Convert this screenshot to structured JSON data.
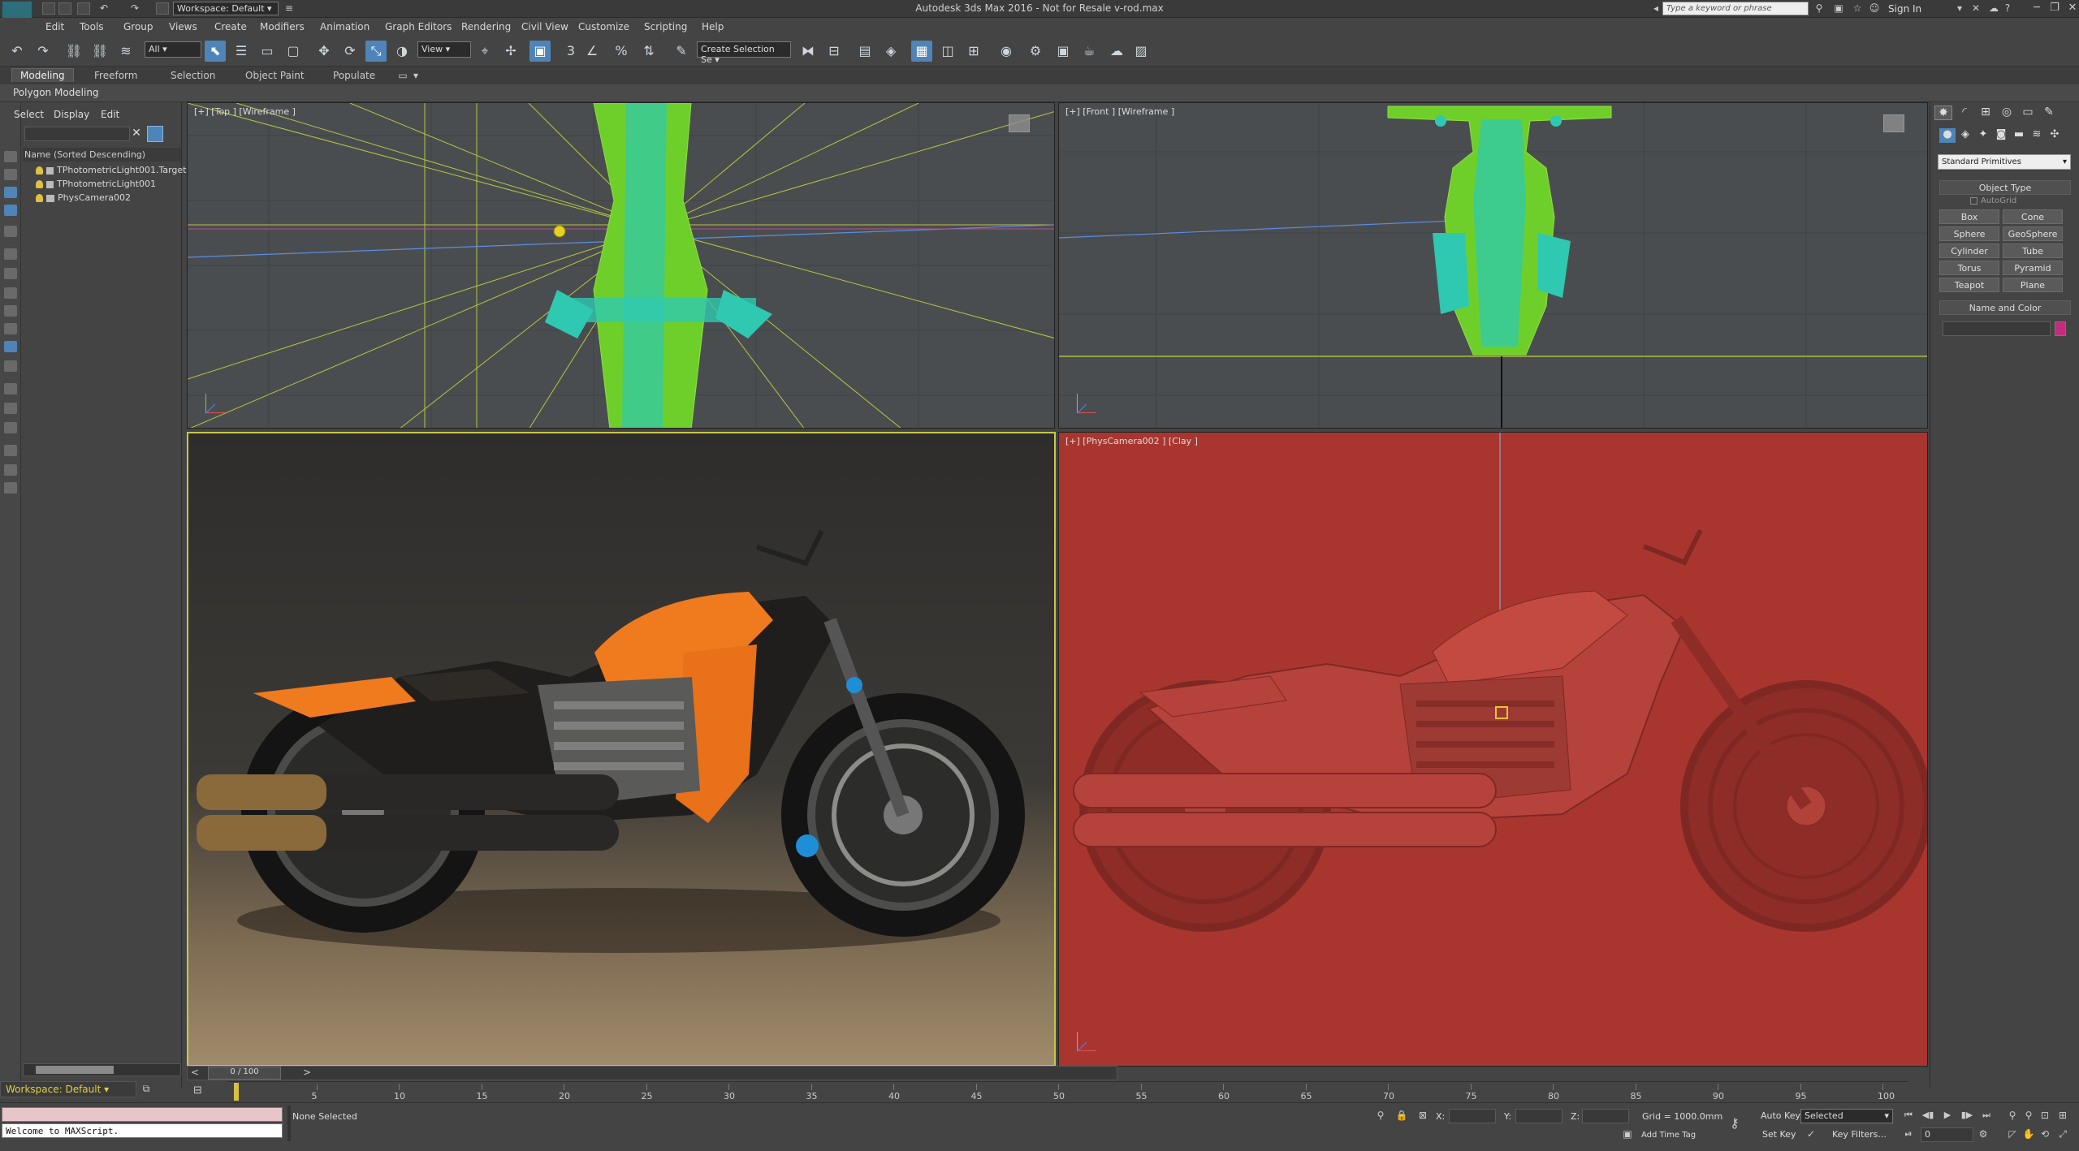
{
  "app": {
    "title": "Autodesk 3ds Max 2016 - Not for Resale    v-rod.max",
    "logo": "MAX",
    "workspace_label": "Workspace: Default",
    "search_placeholder": "Type a keyword or phrase",
    "sign_in": "Sign In",
    "window_controls": [
      "minimize-icon",
      "restore-icon",
      "close-icon"
    ]
  },
  "menu": [
    "Edit",
    "Tools",
    "Group",
    "Views",
    "Create",
    "Modifiers",
    "Animation",
    "Graph Editors",
    "Rendering",
    "Civil View",
    "Customize",
    "Scripting",
    "Help"
  ],
  "toolbar": {
    "selection_filter": "All",
    "reference_coord": "View",
    "named_selection": "Create Selection Se",
    "snap_label": "3"
  },
  "ribbon": {
    "tabs": [
      "Modeling",
      "Freeform",
      "Selection",
      "Object Paint",
      "Populate"
    ],
    "active_tab": "Modeling",
    "sub_label": "Polygon Modeling"
  },
  "explorer": {
    "tabs": [
      "Select",
      "Display",
      "Edit"
    ],
    "column_header": "Name (Sorted Descending)",
    "items": [
      {
        "name": "TPhotometricLight001.Target",
        "icon": "light-bulb-icon"
      },
      {
        "name": "TPhotometricLight001",
        "icon": "light-bulb-icon"
      },
      {
        "name": "PhysCamera002",
        "icon": "camera-icon"
      }
    ],
    "workspace_bottom": "Workspace: Default"
  },
  "viewports": {
    "top": {
      "label": "[+] [Top ] [Wireframe ]"
    },
    "front": {
      "label": "[+] [Front ] [Wireframe ]"
    },
    "render": {
      "label": ""
    },
    "camera": {
      "label": "[+] [PhysCamera002 ] [Clay ]"
    }
  },
  "command_panel": {
    "category": "Standard Primitives",
    "object_type_header": "Object Type",
    "autogrid": "AutoGrid",
    "object_buttons": [
      "Box",
      "Cone",
      "Sphere",
      "GeoSphere",
      "Cylinder",
      "Tube",
      "Torus",
      "Pyramid",
      "Teapot",
      "Plane"
    ],
    "name_color_header": "Name and Color",
    "object_color": "#c42b7c"
  },
  "timeline": {
    "current": "0 / 100",
    "ticks": [
      "5",
      "10",
      "15",
      "20",
      "25",
      "30",
      "35",
      "40",
      "45",
      "50",
      "55",
      "60",
      "65",
      "70",
      "75",
      "80",
      "85",
      "90",
      "95",
      "100"
    ]
  },
  "status": {
    "maxscript_output": "",
    "maxscript_input": "Welcome to MAXScript.",
    "selection": "None Selected",
    "x_label": "X:",
    "y_label": "Y:",
    "z_label": "Z:",
    "grid": "Grid = 1000.0mm",
    "add_time_tag": "Add Time Tag",
    "auto_key": "Auto Key",
    "set_key": "Set Key",
    "key_mode": "Selected",
    "key_filters": "Key Filters...",
    "frame": "0"
  },
  "colors": {
    "accent_blue": "#4f84b8",
    "active_viewport_border": "#c7c74a",
    "clay_red": "#a8362f",
    "wire_green": "#6fcf2a",
    "wire_cyan": "#2ec9b0",
    "bike_orange": "#f07a1e"
  }
}
